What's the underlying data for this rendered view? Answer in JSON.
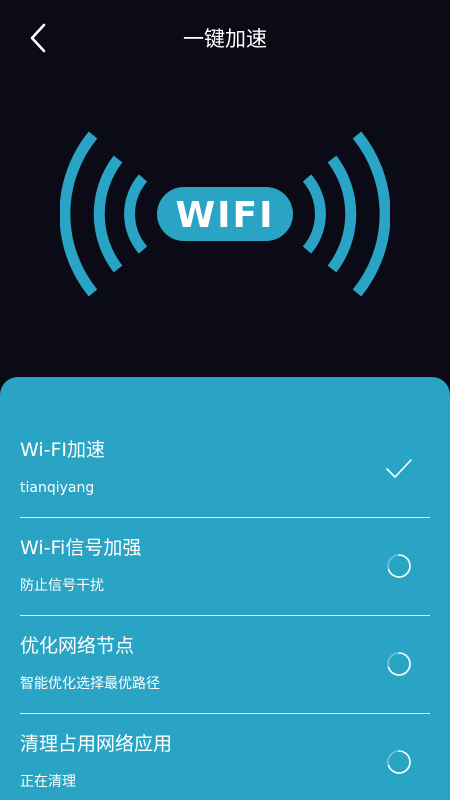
{
  "header": {
    "title": "一键加速",
    "back_icon": "chevron-left-icon"
  },
  "hero": {
    "logo_text": "WIFI",
    "logo_color": "#2aa4c4",
    "background": "#0b0b17"
  },
  "tasks": [
    {
      "name": "Wi-FI加速",
      "detail": "tianqiyang",
      "status": "done",
      "status_icon": "check-icon"
    },
    {
      "name": "Wi-Fi信号加强",
      "detail": "防止信号干扰",
      "status": "running",
      "status_icon": "spinner-icon"
    },
    {
      "name": "优化网络节点",
      "detail": "智能优化选择最优路径",
      "status": "running",
      "status_icon": "spinner-icon"
    },
    {
      "name": "清理占用网络应用",
      "detail": "正在清理",
      "status": "running",
      "status_icon": "spinner-icon"
    }
  ],
  "colors": {
    "accent": "#2aa4c4",
    "text": "#ffffff"
  }
}
